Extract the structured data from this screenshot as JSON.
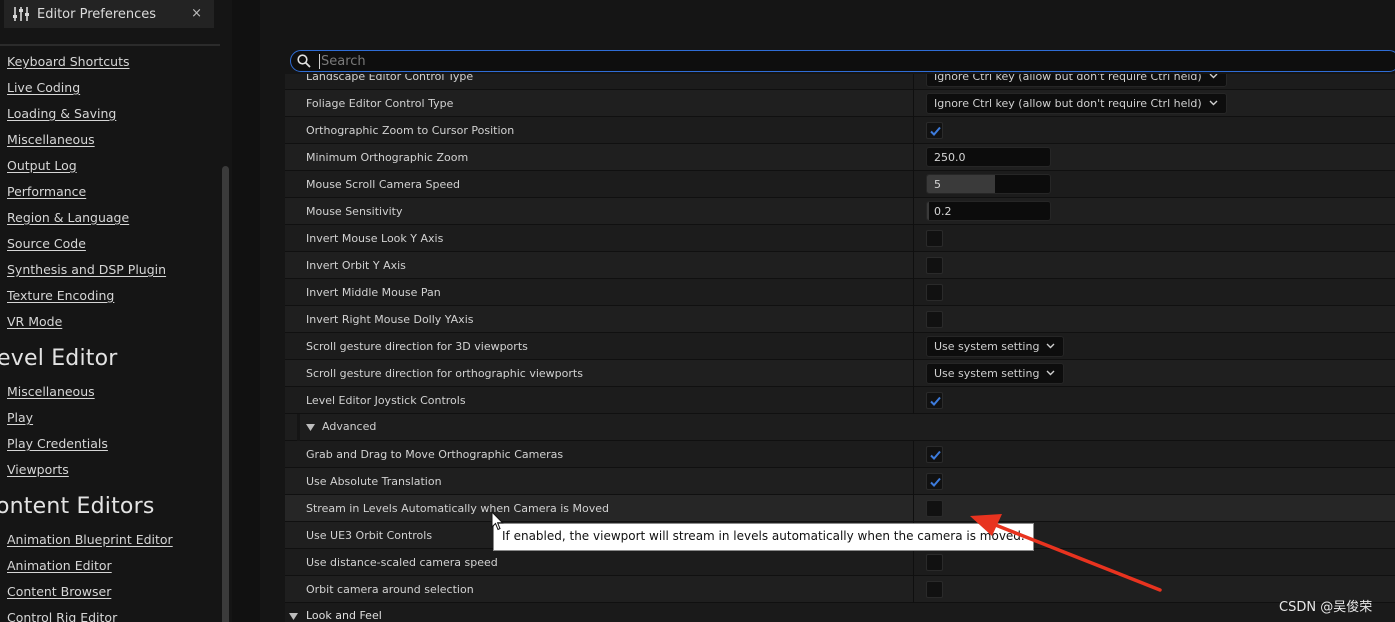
{
  "tab": {
    "title": "Editor Preferences",
    "close": "×"
  },
  "search": {
    "placeholder": "Search",
    "value": ""
  },
  "nav": {
    "links_top": [
      "Keyboard Shortcuts",
      "Live Coding",
      "Loading & Saving",
      "Miscellaneous",
      "Output Log",
      "Performance",
      "Region & Language",
      "Source Code",
      "Synthesis and DSP Plugin",
      "Texture Encoding",
      "VR Mode"
    ],
    "heading_level": "evel Editor",
    "links_level": [
      "Miscellaneous",
      "Play",
      "Play Credentials",
      "Viewports"
    ],
    "heading_content": "ontent Editors",
    "links_content": [
      "Animation Blueprint Editor",
      "Animation Editor",
      "Content Browser",
      "Control Rig Editor"
    ]
  },
  "rows": [
    {
      "label": "Landscape Editor Control Type",
      "control": "dropdown",
      "value": "Ignore Ctrl key (allow but don't require Ctrl held)"
    },
    {
      "label": "Foliage Editor Control Type",
      "control": "dropdown",
      "value": "Ignore Ctrl key (allow but don't require Ctrl held)"
    },
    {
      "label": "Orthographic Zoom to Cursor Position",
      "control": "checkbox",
      "checked": true
    },
    {
      "label": "Minimum Orthographic Zoom",
      "control": "number",
      "value": "250.0"
    },
    {
      "label": "Mouse Scroll Camera Speed",
      "control": "slider",
      "value": "5",
      "fill_fraction": 0.55
    },
    {
      "label": "Mouse Sensitivity",
      "control": "slider",
      "value": "0.2",
      "fill_fraction": 0.02
    },
    {
      "label": "Invert Mouse Look Y Axis",
      "control": "checkbox",
      "checked": false
    },
    {
      "label": "Invert Orbit Y Axis",
      "control": "checkbox",
      "checked": false
    },
    {
      "label": "Invert Middle Mouse Pan",
      "control": "checkbox",
      "checked": false
    },
    {
      "label": "Invert Right Mouse Dolly YAxis",
      "control": "checkbox",
      "checked": false
    },
    {
      "label": "Scroll gesture direction for 3D viewports",
      "control": "dropdown",
      "value": "Use system setting"
    },
    {
      "label": "Scroll gesture direction for orthographic viewports",
      "control": "dropdown",
      "value": "Use system setting"
    },
    {
      "label": "Level Editor Joystick Controls",
      "control": "checkbox",
      "checked": true
    }
  ],
  "advanced": {
    "label": "Advanced",
    "rows": [
      {
        "label": "Grab and Drag to Move Orthographic Cameras",
        "control": "checkbox",
        "checked": true
      },
      {
        "label": "Use Absolute Translation",
        "control": "checkbox",
        "checked": true
      },
      {
        "label": "Stream in Levels Automatically when Camera is Moved",
        "control": "checkbox",
        "checked": false
      },
      {
        "label": "Use UE3 Orbit Controls",
        "control": "checkbox",
        "checked": false
      },
      {
        "label": "Use distance-scaled camera speed",
        "control": "checkbox",
        "checked": false
      },
      {
        "label": "Orbit camera around selection",
        "control": "checkbox",
        "checked": false
      }
    ]
  },
  "next_category": "Look and Feel",
  "tooltip": "If enabled, the viewport will stream in levels automatically when the camera is moved.",
  "watermark": "CSDN @吴俊荣",
  "colors": {
    "accent": "#2f6dd6",
    "check": "#3d7bdc",
    "arrow": "#e8331f"
  }
}
